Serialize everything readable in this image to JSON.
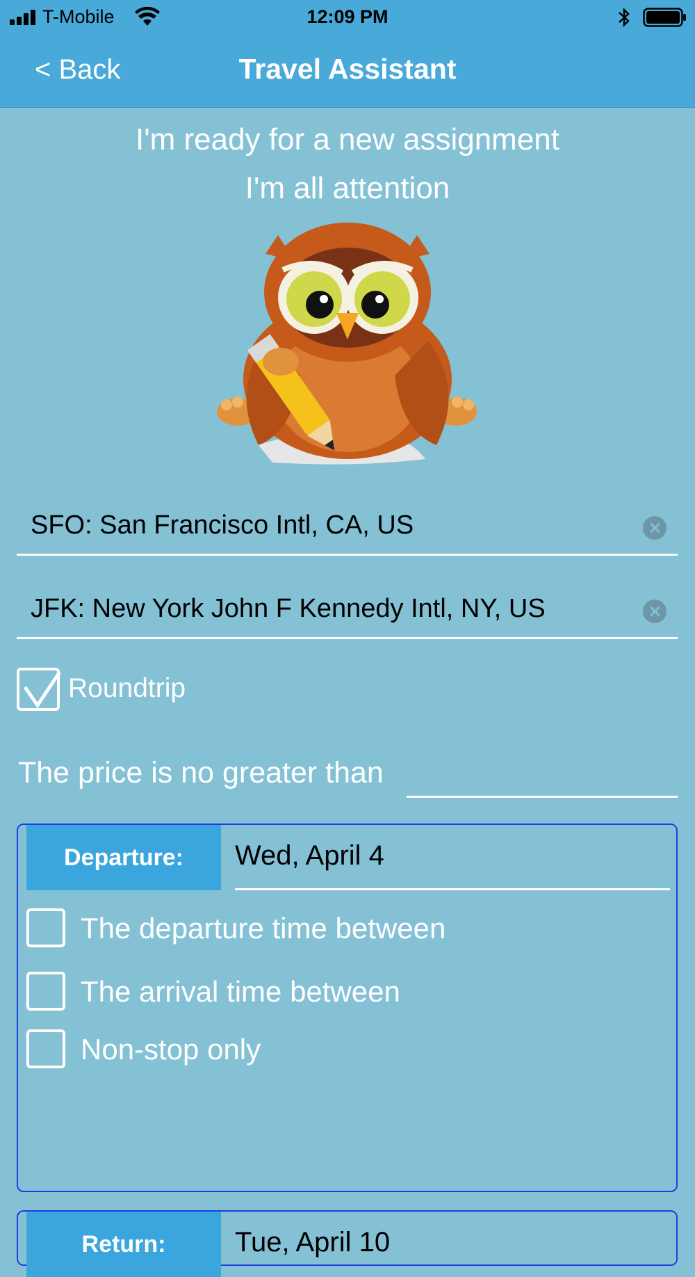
{
  "status_bar": {
    "carrier": "T-Mobile",
    "time": "12:09 PM"
  },
  "nav": {
    "back_label": "< Back",
    "title": "Travel Assistant"
  },
  "assistant": {
    "line1": "I'm ready for a new assignment",
    "line2": "I'm all attention"
  },
  "route": {
    "from": "SFO: San Francisco Intl, CA, US",
    "to": "JFK: New York John F Kennedy Intl, NY, US"
  },
  "roundtrip": {
    "label": "Roundtrip",
    "checked": true
  },
  "price": {
    "label": "The price is no greater than",
    "value": ""
  },
  "departure": {
    "tag": "Departure:",
    "date": "Wed, April 4",
    "options": [
      {
        "label": "The departure time between",
        "checked": false
      },
      {
        "label": "The arrival time between",
        "checked": false
      },
      {
        "label": "Non-stop only",
        "checked": false
      }
    ]
  },
  "return": {
    "tag": "Return:",
    "date": "Tue, April 10"
  },
  "colors": {
    "header": "#49a9d9",
    "background": "#84c1d5",
    "tag": "#3aa6dd",
    "panel_border": "#1e3fe0"
  }
}
